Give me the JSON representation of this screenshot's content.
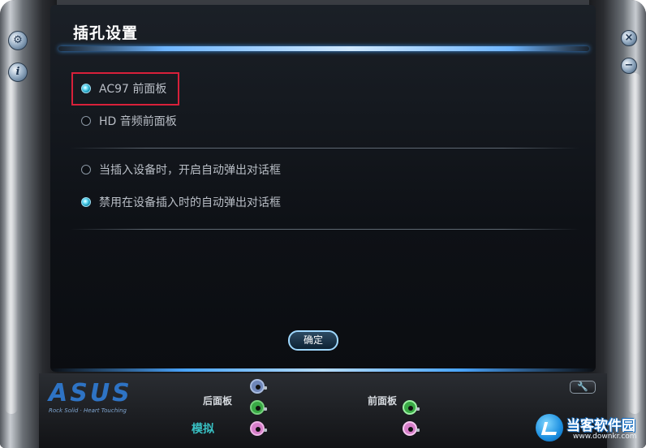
{
  "dialog": {
    "title": "插孔设置"
  },
  "options": {
    "panel_type": [
      {
        "label": "AC97 前面板",
        "selected": true
      },
      {
        "label": "HD 音频前面板",
        "selected": false
      }
    ],
    "popup": [
      {
        "label": "当插入设备时，开启自动弹出对话框",
        "selected": false
      },
      {
        "label": "禁用在设备插入时的自动弹出对话框",
        "selected": true
      }
    ]
  },
  "buttons": {
    "ok_label": "确定",
    "info_glyph": "i",
    "close_glyph": "×",
    "minimize_glyph": "−",
    "wrench_glyph": "🔧"
  },
  "footer": {
    "brand": "ASUS",
    "brand_tagline": "Rock Solid · Heart Touching",
    "back_panel_label": "后面板",
    "front_panel_label": "前面板",
    "analog_label": "模拟",
    "jack_colors": {
      "blue": "#6f86b8",
      "green": "#39a945",
      "pink": "#d67ec9"
    }
  },
  "watermark": {
    "title": "当客软件园",
    "url": "www.downkr.com"
  },
  "colors": {
    "accent": "#3d8fe0",
    "highlight_box": "#d8203a",
    "selected_radio": "#1597b8"
  }
}
